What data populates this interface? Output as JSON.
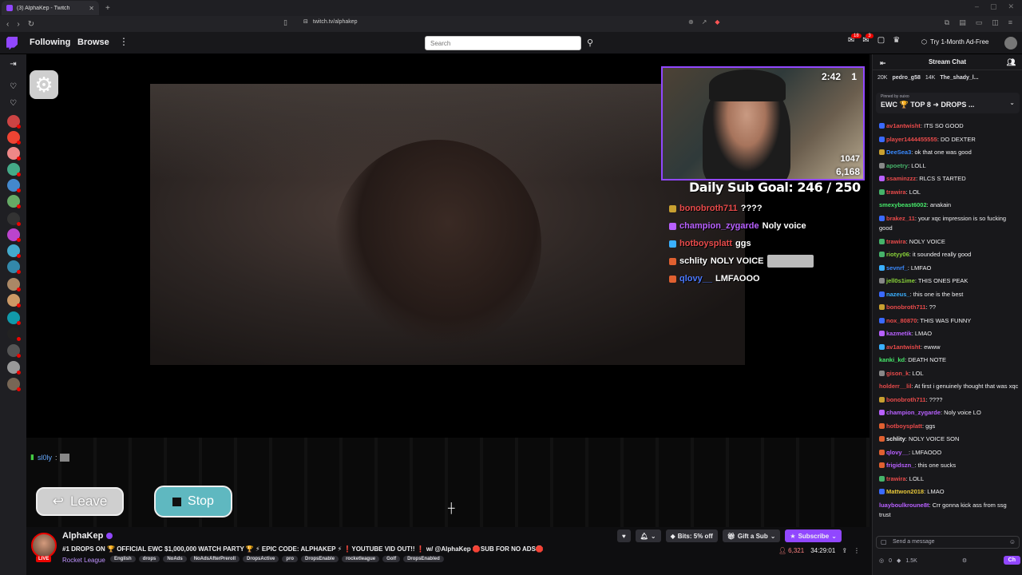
{
  "browser": {
    "tab_title": "(3) AlphaKep - Twitch",
    "url": "twitch.tv/alphakep"
  },
  "nav": {
    "following": "Following",
    "browse": "Browse",
    "search_placeholder": "Search",
    "notif_count": "18",
    "inbox_count": "3",
    "ad_free": "Try 1-Month Ad-Free"
  },
  "player": {
    "overlay": {
      "cam_time": "2:42",
      "cam_count": "1",
      "cam_stat1": "1047",
      "cam_stat2": "6,168",
      "sub_goal": "Daily Sub Goal: 246 / 250",
      "chat": [
        {
          "user": "bonobroth711",
          "text": "????",
          "color": "#e84a4a"
        },
        {
          "user": "champion_zygarde",
          "text": "Noly voice",
          "color": "#b860ff"
        },
        {
          "user": "hotboysplatt",
          "text": "ggs",
          "color": "#e84a4a"
        },
        {
          "user": "schlity",
          "text": "NOLY VOICE",
          "color": "#ffffff"
        },
        {
          "user": "qlovy__",
          "text": "LMFAOOO",
          "color": "#4a78ff"
        }
      ]
    },
    "small_chat_user": "sl0ly",
    "leave_label": "Leave",
    "stop_label": "Stop"
  },
  "stream": {
    "channel": "AlphaKep",
    "live": "LIVE",
    "title": "#1 DROPS ON 🏆 OFFICIAL EWC $1,000,000 WATCH PARTY 🏆 ⚡ EPIC CODE: ALPHAKEP ⚡ ❗YOUTUBE VID OUT!! ❗ w/ @AlphaKep 🛑SUB FOR NO ADS🛑",
    "category": "Rocket League",
    "tags": [
      "English",
      "drops",
      "NoAds",
      "NoAdsAfterPreroll",
      "DropsActive",
      "pro",
      "DropsEnable",
      "rocketleague",
      "Golf",
      "DropsEnabled"
    ],
    "bits": "Bits: 5% off",
    "gift": "Gift a Sub",
    "subscribe": "Subscribe",
    "viewers": "6,321",
    "uptime": "34:29:01"
  },
  "chat": {
    "header": "Stream Chat",
    "hype": [
      "20K",
      "pedro_g58",
      "14K",
      "The_shady_l..."
    ],
    "pinned_label": "Pinned by",
    "pinned_by": "ouixo",
    "pinned_text": "EWC 🏆 TOP 8 ➜ DROPS ...",
    "messages": [
      {
        "user": "av1antwisht",
        "text": "ITS SO GOOD",
        "color": "#e84a4a",
        "badge": "#3a6aff"
      },
      {
        "user": "player1444455555",
        "text": "DO DEXTER",
        "color": "#e84a4a",
        "badge": "#3a6aff"
      },
      {
        "user": "DeeSea3",
        "text": "ok that one was good",
        "color": "#3a8aff",
        "badge": "#c8a030"
      },
      {
        "user": "apoetry",
        "text": "LOLL",
        "color": "#46b36a",
        "badge": "#888888"
      },
      {
        "user": "ssaminzzz",
        "text": "RLCS S TARTED",
        "color": "#e84a4a",
        "badge": "#b860ff"
      },
      {
        "user": "trawira",
        "text": "LOL",
        "color": "#e84a4a",
        "badge": "#46b36a"
      },
      {
        "user": "smexybeast6002",
        "text": "anakain",
        "color": "#46e86a",
        "badge": ""
      },
      {
        "user": "brakez_11",
        "text": "your xqc impression is so fucking good",
        "color": "#e84a4a",
        "badge": "#3a6aff",
        "wrap": true
      },
      {
        "user": "trawira",
        "text": "NOLY VOICE",
        "color": "#e84a4a",
        "badge": "#46b36a"
      },
      {
        "user": "riotyy06",
        "text": "it sounded really good",
        "color": "#8ad43a",
        "badge": "#46b36a"
      },
      {
        "user": "sevnrf_",
        "text": "LMFAO",
        "color": "#3a8aff",
        "badge": "#3ab0ff"
      },
      {
        "user": "jell0s1ime",
        "text": "THIS ONES PEAK",
        "color": "#8ad43a",
        "badge": "#888888"
      },
      {
        "user": "nazeus_",
        "text": "this one is the best",
        "color": "#3ab0ff",
        "badge": "#3a6aff"
      },
      {
        "user": "bonobroth711",
        "text": "??",
        "color": "#e84a4a",
        "badge": "#c8a030"
      },
      {
        "user": "nox_80870",
        "text": "THIS WAS FUNNY",
        "color": "#e84a4a",
        "badge": "#3a6aff"
      },
      {
        "user": "kazmetik",
        "text": "LMAO",
        "color": "#b860ff",
        "badge": "#b860ff"
      },
      {
        "user": "av1antwisht",
        "text": "ewww",
        "color": "#e84a4a",
        "badge": "#3ab0ff"
      },
      {
        "user": "kanki_kd",
        "text": "DEATH NOTE",
        "color": "#46e86a",
        "badge": ""
      },
      {
        "user": "gison_k",
        "text": "LOL",
        "color": "#e84a4a",
        "badge": "#888888"
      },
      {
        "user": "holderr__lil",
        "text": "At first i genuinely thought that was xqc",
        "color": "#e84a4a",
        "badge": "",
        "wrap": true
      },
      {
        "user": "bonobroth711",
        "text": "????",
        "color": "#e84a4a",
        "badge": "#c8a030"
      },
      {
        "user": "champion_zygarde",
        "text": "Noly voice LO",
        "color": "#b860ff",
        "badge": "#b860ff"
      },
      {
        "user": "hotboysplatt",
        "text": "ggs",
        "color": "#e84a4a",
        "badge": "#e06030"
      },
      {
        "user": "schlity",
        "text": "NOLY VOICE SON",
        "color": "#efeff1",
        "badge": "#e06030"
      },
      {
        "user": "qlovy__",
        "text": "LMFAOOO",
        "color": "#b860ff",
        "badge": "#e06030"
      },
      {
        "user": "frigidszn_",
        "text": "this one sucks",
        "color": "#b860ff",
        "badge": "#e06030"
      },
      {
        "user": "trawira",
        "text": "LOLL",
        "color": "#e84a4a",
        "badge": "#46b36a"
      },
      {
        "user": "Mattwon2018",
        "text": "LMAO",
        "color": "#e8c83a",
        "badge": "#3a6aff"
      },
      {
        "user": "luayboulkroune8t",
        "text": "Crr gonna kick ass from ssg trust",
        "color": "#b860ff",
        "badge": "",
        "wrap": true
      }
    ],
    "input_placeholder": "Send a message",
    "points": "0",
    "bits_count": "1.5K",
    "chat_button": "Ch"
  }
}
